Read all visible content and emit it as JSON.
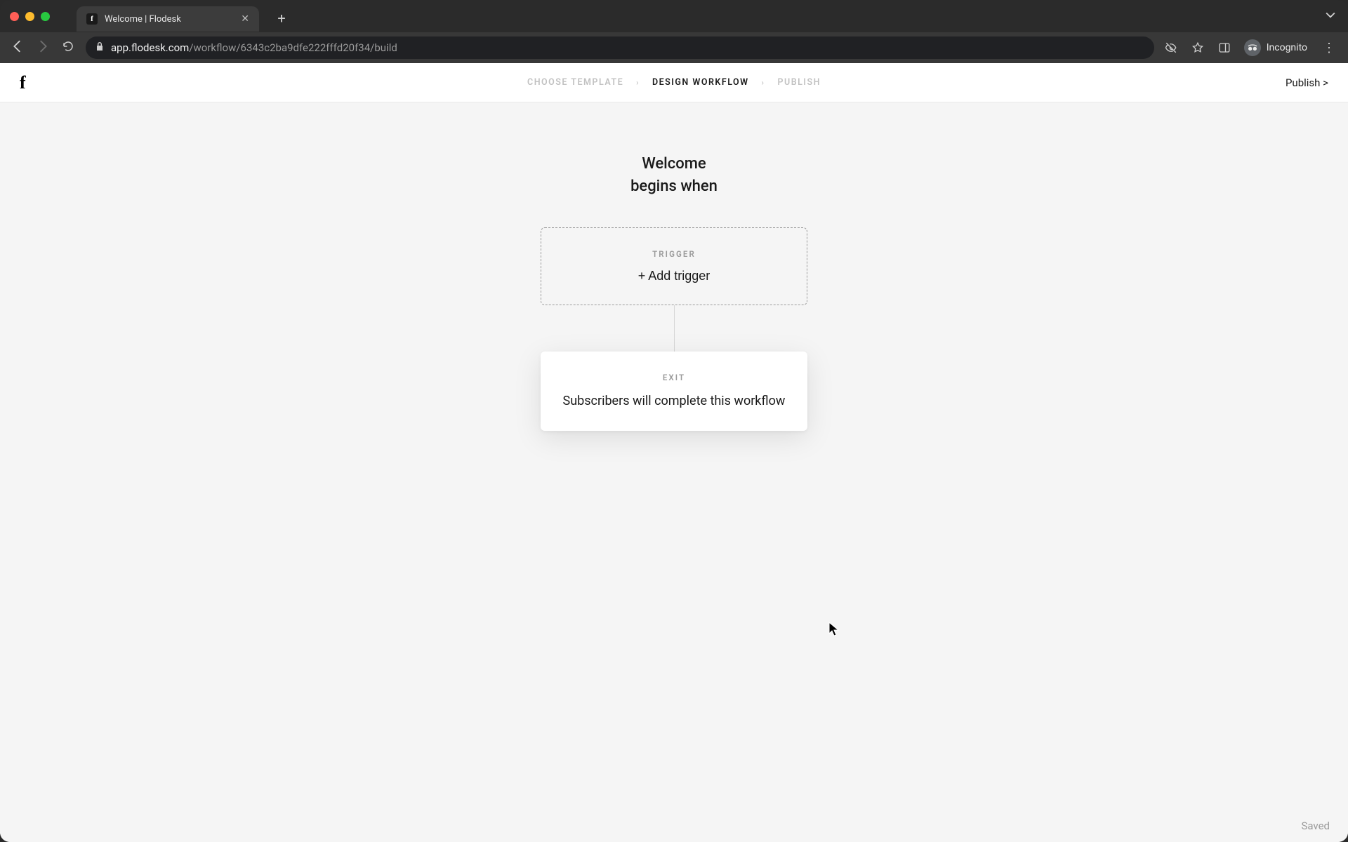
{
  "browser": {
    "tab_title": "Welcome | Flodesk",
    "url_host": "app.flodesk.com",
    "url_path": "/workflow/6343c2ba9dfe222fffd20f34/build",
    "incognito_label": "Incognito"
  },
  "header": {
    "steps": [
      {
        "label": "CHOOSE TEMPLATE",
        "active": false
      },
      {
        "label": "DESIGN WORKFLOW",
        "active": true
      },
      {
        "label": "PUBLISH",
        "active": false
      }
    ],
    "publish_link": "Publish >"
  },
  "workflow": {
    "title_line1": "Welcome",
    "title_line2": "begins when",
    "trigger": {
      "label": "TRIGGER",
      "add_text": "+ Add trigger"
    },
    "exit": {
      "label": "EXIT",
      "text": "Subscribers will complete this workflow"
    }
  },
  "status": {
    "saved": "Saved"
  }
}
